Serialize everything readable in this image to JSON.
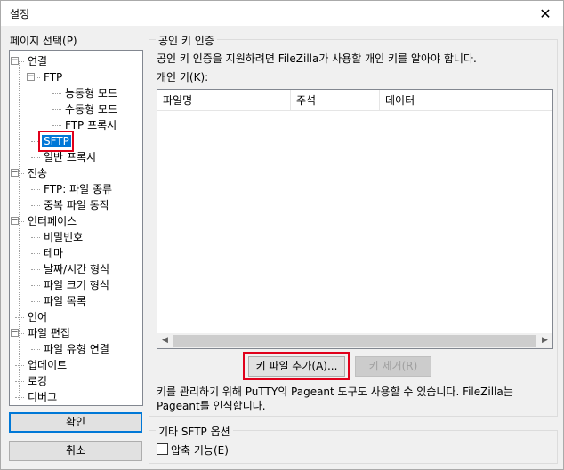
{
  "window": {
    "title": "설정",
    "close": "✕"
  },
  "left": {
    "label": "페이지 선택(P)",
    "tree": [
      {
        "label": "연결",
        "level": 0,
        "expander": "−"
      },
      {
        "label": "FTP",
        "level": 1,
        "expander": "−"
      },
      {
        "label": "능동형 모드",
        "level": 2
      },
      {
        "label": "수동형 모드",
        "level": 2
      },
      {
        "label": "FTP 프록시",
        "level": 2
      },
      {
        "label": "SFTP",
        "level": 1,
        "selected": true
      },
      {
        "label": "일반 프록시",
        "level": 1
      },
      {
        "label": "전송",
        "level": 0,
        "expander": "−"
      },
      {
        "label": "FTP: 파일 종류",
        "level": 1
      },
      {
        "label": "중복 파일 동작",
        "level": 1
      },
      {
        "label": "인터페이스",
        "level": 0,
        "expander": "−"
      },
      {
        "label": "비밀번호",
        "level": 1
      },
      {
        "label": "테마",
        "level": 1
      },
      {
        "label": "날짜/시간 형식",
        "level": 1
      },
      {
        "label": "파일 크기 형식",
        "level": 1
      },
      {
        "label": "파일 목록",
        "level": 1
      },
      {
        "label": "언어",
        "level": 0
      },
      {
        "label": "파일 편집",
        "level": 0,
        "expander": "−"
      },
      {
        "label": "파일 유형 연결",
        "level": 1
      },
      {
        "label": "업데이트",
        "level": 0
      },
      {
        "label": "로깅",
        "level": 0
      },
      {
        "label": "디버그",
        "level": 0
      }
    ],
    "ok_label": "확인",
    "cancel_label": "취소"
  },
  "pubkey": {
    "group_title": "공인 키 인증",
    "description": "공인 키 인증을 지원하려면 FileZilla가 사용할 개인 키를 알아야 합니다.",
    "list_label": "개인 키(K):",
    "columns": [
      "파일명",
      "주석",
      "데이터"
    ],
    "add_label": "키 파일 추가(A)...",
    "remove_label": "키 제거(R)",
    "note_line1": "키를 관리하기 위해 PuTTY의 Pageant 도구도 사용할 수 있습니다. FileZilla는",
    "note_line2": "Pageant를 인식합니다."
  },
  "other": {
    "group_title": "기타 SFTP 옵션",
    "compress_label": "압축 기능(E)"
  },
  "scroll": {
    "left_arrow": "◀",
    "right_arrow": "▶"
  }
}
